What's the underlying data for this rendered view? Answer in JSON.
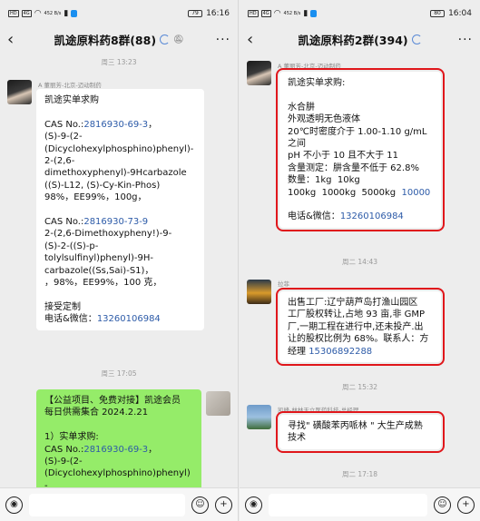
{
  "left": {
    "status": {
      "net_speed": "452 B/s",
      "battery": "79",
      "time": "16:16"
    },
    "title": "凯途原料药8群(88)",
    "timestamps": [
      "周三 13:23",
      "周三 17:05"
    ],
    "msg1": {
      "sender": "A 董丽芳-北京-迈动制药",
      "lines": [
        "凯途实单求购",
        "",
        "CAS No.:2816930-69-3，",
        "(S)-9-(2-",
        "(Dicyclohexylphosphino)phenyl)-",
        "2-(2,6-",
        "dimethoxyphenyl)-9Hcarbazole",
        "((S)-L12, (S)-Cy-Kin-Phos)",
        "98%，EE99%，100g，",
        "",
        "CAS No.:2816930-73-9",
        "2-(2,6-Dimethoxypheny!)-9-",
        "(S)-2-((S)-p-",
        "tolylsulfinyl)phenyl)-9H-",
        "carbazole((Ss,Sai)-S1)，",
        "，98%，EE99%，100 克，",
        "",
        "接受定制",
        "电话&微信：13260106984"
      ]
    },
    "msg2": {
      "lines": [
        "【公益项目、免费对接】凯途会员",
        "每日供需集合 2024.2.21",
        "",
        "1）实单求购:",
        "CAS No.:2816930-69-3，",
        "(S)-9-(2-",
        "(Dicyclohexylphosphino)phenyl)-"
      ]
    }
  },
  "right": {
    "status": {
      "net_speed": "452 B/s",
      "battery": "80",
      "time": "16:04"
    },
    "title": "凯途原料药2群(394)",
    "timestamps": [
      "周二 14:43",
      "周二 15:32",
      "周二 17:18"
    ],
    "msg1": {
      "sender": "A 董丽芳-北京-迈动制药",
      "lines": [
        "凯途实单求购:",
        "",
        "水合肼",
        "外观透明无色液体",
        "20℃时密度介于 1.00-1.10 g/mL",
        "之间",
        "pH 不小于 10 且不大于 11",
        "含量测定：肼含量不低于 62.8%",
        "数量：1kg  10kg",
        "100kg  1000kg  5000kg  10000kg",
        "",
        "电话&微信：13260106984"
      ]
    },
    "msg2": {
      "sender": "拉菲",
      "lines": [
        "出售工厂:辽宁葫芦岛打渔山园区",
        "工厂股权转让,占地 93 亩,非 GMP",
        "厂,一期工程在进行中,还未投产.出",
        "让的股权比例为 68%。联系人：方",
        "经理 15306892288"
      ]
    },
    "msg3": {
      "sender": "凯峰-林林天立医药科技-总经理",
      "lines": [
        "寻找\" 磺酸苯丙哌林 \" 大生产成熟",
        "技术"
      ]
    }
  },
  "icons": {
    "back": "‹",
    "more": "···",
    "voice": "◉",
    "emoji": "☺",
    "plus": "+"
  }
}
